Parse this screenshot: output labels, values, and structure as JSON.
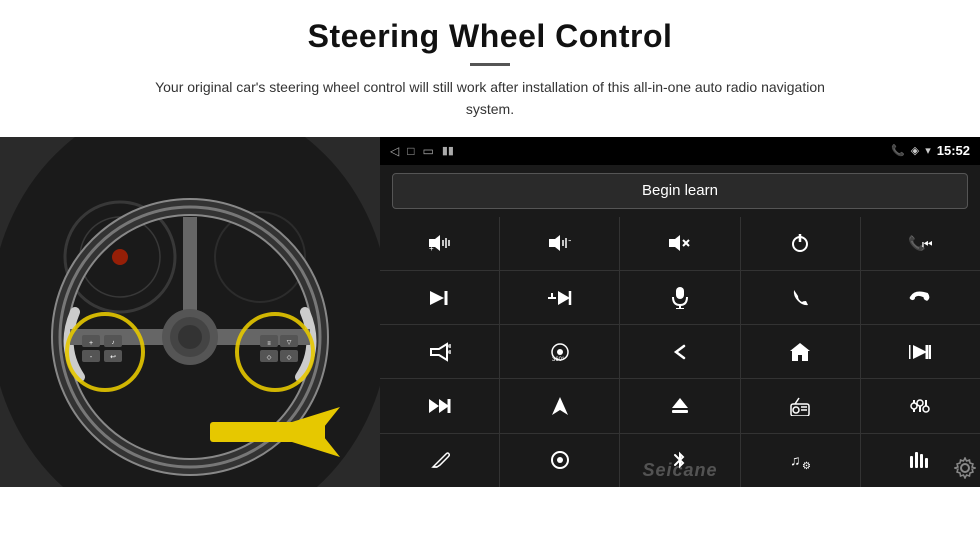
{
  "header": {
    "title": "Steering Wheel Control",
    "subtitle": "Your original car's steering wheel control will still work after installation of this all-in-one auto radio navigation system."
  },
  "statusBar": {
    "back_icon": "◁",
    "home_icon": "□",
    "recent_icon": "▭",
    "battery_icon": "▮▮",
    "phone_icon": "📞",
    "location_icon": "◈",
    "wifi_icon": "▾",
    "time": "15:52"
  },
  "beginLearn": {
    "label": "Begin learn"
  },
  "controls": [
    {
      "icon": "🔊+",
      "id": "vol-up"
    },
    {
      "icon": "🔊-",
      "id": "vol-down"
    },
    {
      "icon": "🔇",
      "id": "mute"
    },
    {
      "icon": "⏻",
      "id": "power"
    },
    {
      "icon": "📞⏮",
      "id": "phone-prev"
    },
    {
      "icon": "⏭",
      "id": "next-track"
    },
    {
      "icon": "✂⏭",
      "id": "seek-next"
    },
    {
      "icon": "🎤",
      "id": "mic"
    },
    {
      "icon": "📞",
      "id": "call"
    },
    {
      "icon": "📞↩",
      "id": "hangup"
    },
    {
      "icon": "📢",
      "id": "horn"
    },
    {
      "icon": "360°",
      "id": "camera-360"
    },
    {
      "icon": "↩",
      "id": "back"
    },
    {
      "icon": "⌂",
      "id": "home"
    },
    {
      "icon": "⏮⏮",
      "id": "prev-track"
    },
    {
      "icon": "⏭⏭",
      "id": "fast-fwd"
    },
    {
      "icon": "▶",
      "id": "navigate"
    },
    {
      "icon": "⏏",
      "id": "eject"
    },
    {
      "icon": "📻",
      "id": "radio"
    },
    {
      "icon": "⚙≡",
      "id": "settings-eq"
    },
    {
      "icon": "✏",
      "id": "edit"
    },
    {
      "icon": "⊙",
      "id": "circle-btn"
    },
    {
      "icon": "✱",
      "id": "bluetooth"
    },
    {
      "icon": "♪⚙",
      "id": "music-settings"
    },
    {
      "icon": "▐▌▐",
      "id": "equalizer"
    }
  ],
  "watermark": "Seicane",
  "colors": {
    "bg": "#fff",
    "headunit_bg": "#111",
    "cell_bg": "#1a1a1a",
    "grid_gap": "#333"
  }
}
